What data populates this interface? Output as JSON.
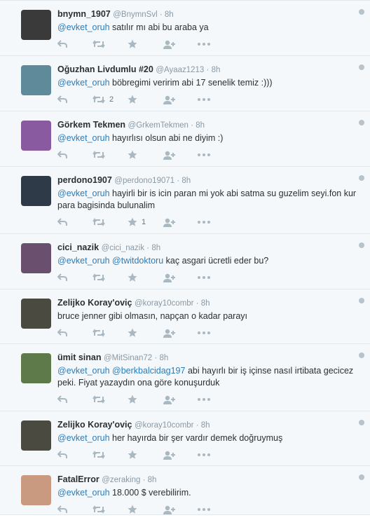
{
  "tweets": [
    {
      "name": "bnymn_1907",
      "handle": "@BnymnSvl",
      "time": "8h",
      "mention": "@evket_oruh",
      "mention2": "",
      "text": "satılır mı abi bu araba ya",
      "retweets": "",
      "favorites": "",
      "avatar_color": "#3a3a3a",
      "height": 80
    },
    {
      "name": "Oğuzhan Livdumlu #20",
      "handle": "@Ayaaz1213",
      "time": "8h",
      "mention": "@evket_oruh",
      "mention2": "",
      "text": "böbregimi veririm abi 17 senelik temiz :)))",
      "retweets": "2",
      "favorites": "",
      "avatar_color": "#5e8a9a",
      "height": 79
    },
    {
      "name": "Görkem Tekmen",
      "handle": "@GrkemTekmen",
      "time": "8h",
      "mention": "@evket_oruh",
      "mention2": "",
      "text": "hayırlısı olsun abi ne diyim :)",
      "retweets": "",
      "favorites": "",
      "avatar_color": "#8a5aa0",
      "height": 79
    },
    {
      "name": "perdono1907",
      "handle": "@perdono19071",
      "time": "8h",
      "mention": "@evket_oruh",
      "mention2": "",
      "text": "hayirli bir is icin paran mi yok abi satma su guzelim seyi.fon kur para bagisinda bulunalim",
      "retweets": "",
      "favorites": "1",
      "avatar_color": "#2e3a48",
      "height": 96
    },
    {
      "name": "cici_nazik",
      "handle": "@cici_nazik",
      "time": "8h",
      "mention": "@evket_oruh",
      "mention2": "@twitdoktoru",
      "text": "kaç asgari ücretli eder bu?",
      "retweets": "",
      "favorites": "",
      "avatar_color": "#6b4f6e",
      "height": 79
    },
    {
      "name": "Zelijko Koray'oviç",
      "handle": "@koray10combr",
      "time": "8h",
      "mention": "",
      "mention2": "",
      "text": "bruce jenner gibi olmasın, napçan o kadar parayı",
      "retweets": "",
      "favorites": "",
      "avatar_color": "#4a4a40",
      "height": 78
    },
    {
      "name": "ümit sinan",
      "handle": "@MitSinan72",
      "time": "8h",
      "mention": "@evket_oruh",
      "mention2": "@berkbalcidag197",
      "text": "abi hayırlı bir iş içinse nasıl irtibata gecicez peki. Fiyat yazaydın ona göre konuşurduk",
      "retweets": "",
      "favorites": "",
      "avatar_color": "#5f7a4a",
      "height": 96
    },
    {
      "name": "Zelijko Koray'oviç",
      "handle": "@koray10combr",
      "time": "8h",
      "mention": "@evket_oruh",
      "mention2": "",
      "text": "her hayırda bir şer vardır demek doğruymuş",
      "retweets": "",
      "favorites": "",
      "avatar_color": "#4a4a40",
      "height": 78
    },
    {
      "name": "FatalError",
      "handle": "@zeraking",
      "time": "8h",
      "mention": "@evket_oruh",
      "mention2": "",
      "text": "18.000 $ verebilirim.",
      "retweets": "",
      "favorites": "",
      "avatar_color": "#c99a80",
      "height": 70
    }
  ],
  "icons": {
    "reply": "reply-icon",
    "retweet": "retweet-icon",
    "favorite": "star-icon",
    "follow": "follow-icon",
    "more": "more-icon"
  }
}
